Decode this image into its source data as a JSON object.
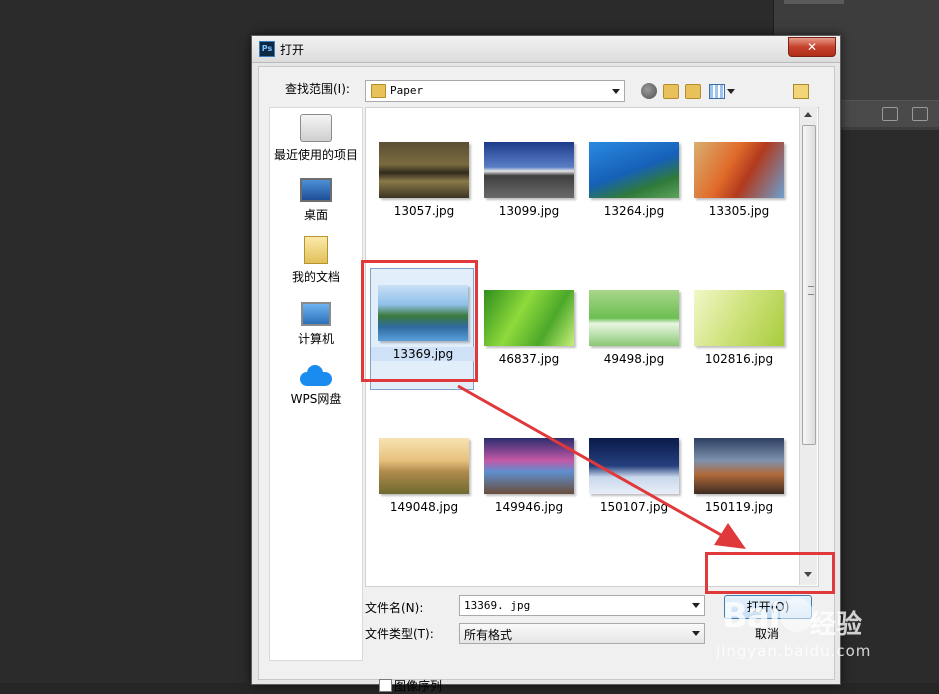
{
  "window": {
    "title": "打开",
    "app_icon_text": "Ps",
    "close_glyph": "✕"
  },
  "toolbar": {
    "look_in_label": "查找范围(I):",
    "look_in_value": "Paper"
  },
  "places": [
    {
      "label": "最近使用的项目",
      "icon": "recent-items-icon"
    },
    {
      "label": "桌面",
      "icon": "desktop-icon"
    },
    {
      "label": "我的文档",
      "icon": "my-documents-icon"
    },
    {
      "label": "计算机",
      "icon": "computer-icon"
    },
    {
      "label": "WPS网盘",
      "icon": "wps-cloud-icon"
    }
  ],
  "files": [
    {
      "name": "13057.jpg",
      "selected": false
    },
    {
      "name": "13099.jpg",
      "selected": false
    },
    {
      "name": "13264.jpg",
      "selected": false
    },
    {
      "name": "13305.jpg",
      "selected": false
    },
    {
      "name": "13369.jpg",
      "selected": true
    },
    {
      "name": "46837.jpg",
      "selected": false
    },
    {
      "name": "49498.jpg",
      "selected": false
    },
    {
      "name": "102816.jpg",
      "selected": false
    },
    {
      "name": "149048.jpg",
      "selected": false
    },
    {
      "name": "149946.jpg",
      "selected": false
    },
    {
      "name": "150107.jpg",
      "selected": false
    },
    {
      "name": "150119.jpg",
      "selected": false
    }
  ],
  "filename": {
    "label": "文件名(N):",
    "value": "13369. jpg"
  },
  "filetype": {
    "label": "文件类型(T):",
    "value": "所有格式"
  },
  "buttons": {
    "open": "打开(O)",
    "cancel": "取消"
  },
  "image_sequence": {
    "label": "图像序列",
    "checked": false
  },
  "annotation": {
    "color": "#e0393b"
  },
  "watermark": {
    "brand": "Bai",
    "brand2": "经验",
    "url": "jingyan.baidu.com"
  }
}
